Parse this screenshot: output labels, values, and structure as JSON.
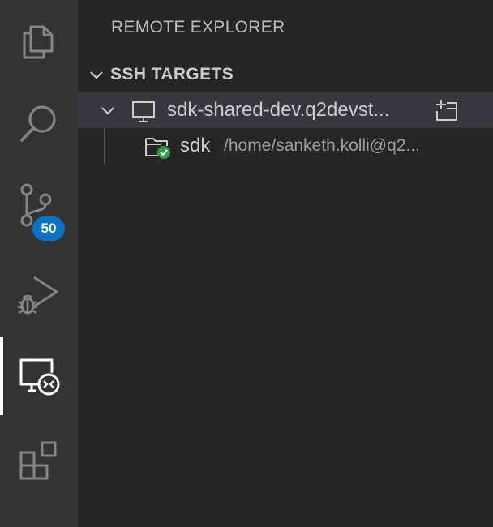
{
  "activity_bar": {
    "items": [
      {
        "name": "explorer",
        "icon": "files-icon"
      },
      {
        "name": "search",
        "icon": "search-icon"
      },
      {
        "name": "source-control",
        "icon": "source-control-icon",
        "badge": "50"
      },
      {
        "name": "run-debug",
        "icon": "run-debug-icon"
      },
      {
        "name": "remote-explorer",
        "icon": "remote-explorer-icon",
        "active": true
      },
      {
        "name": "extensions",
        "icon": "extensions-icon"
      }
    ]
  },
  "side_bar": {
    "title": "REMOTE EXPLORER",
    "section": {
      "label": "SSH TARGETS",
      "expanded": true,
      "host": {
        "label": "sdk-shared-dev.q2devst...",
        "expanded": true,
        "selected": true,
        "folder": {
          "label": "sdk",
          "description": "/home/sanketh.kolli@q2..."
        }
      }
    }
  },
  "colors": {
    "activity_bar_bg": "#333333",
    "side_bar_bg": "#252526",
    "selection_bg": "#37373d",
    "badge_bg": "#0a72c2",
    "connected_green": "#2ea043"
  }
}
